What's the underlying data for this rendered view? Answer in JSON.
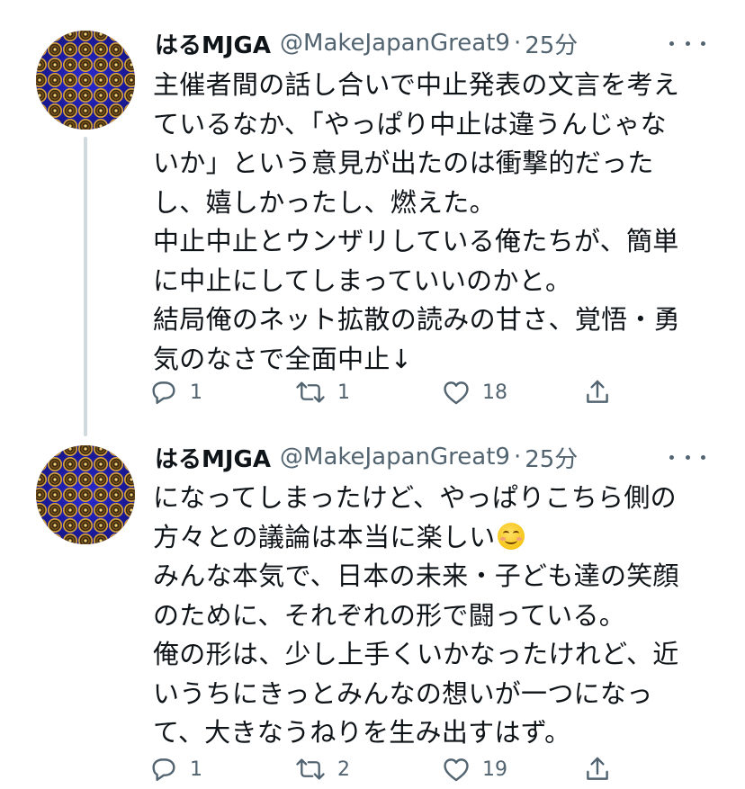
{
  "tweets": [
    {
      "display_name": "はるMJGA",
      "handle": "@MakeJapanGreat9",
      "separator": "·",
      "time": "25分",
      "lines": [
        "主催者間の話し合いで中止発表の文言を考え",
        "ているなか、「やっぱり中止は違うんじゃな",
        "いか」という意見が出たのは衝撃的だった",
        "し、嬉しかったし、燃えた。",
        "中止中止とウンザリしている俺たちが、簡単",
        "に中止にしてしまっていいのかと。",
        "結局俺のネット拡散の読みの甘さ、覚悟・勇",
        "気のなさで全面中止↓"
      ],
      "reply_count": "1",
      "retweet_count": "1",
      "like_count": "18"
    },
    {
      "display_name": "はるMJGA",
      "handle": "@MakeJapanGreat9",
      "separator": "·",
      "time": "25分",
      "lines": [
        "になってしまったけど、やっぱりこちら側の",
        "方々との議論は本当に楽しい",
        "みんな本気で、日本の未来・子ども達の笑顔",
        "のために、それぞれの形で闘っている。",
        "俺の形は、少し上手くいかなったけれど、近",
        "いうちにきっとみんなの想いが一つになっ",
        "て、大きなうねりを生み出すはず。"
      ],
      "emoji": "smiling-face-emoji",
      "reply_count": "1",
      "retweet_count": "2",
      "like_count": "19"
    }
  ],
  "icons": {
    "reply": "reply-icon",
    "retweet": "retweet-icon",
    "like": "heart-icon",
    "share": "share-icon",
    "more": "more-icon"
  },
  "colors": {
    "text": "#0f1419",
    "secondary": "#536471",
    "thread_line": "#cfd9de",
    "avatar_blue": "#2b2bd6"
  }
}
